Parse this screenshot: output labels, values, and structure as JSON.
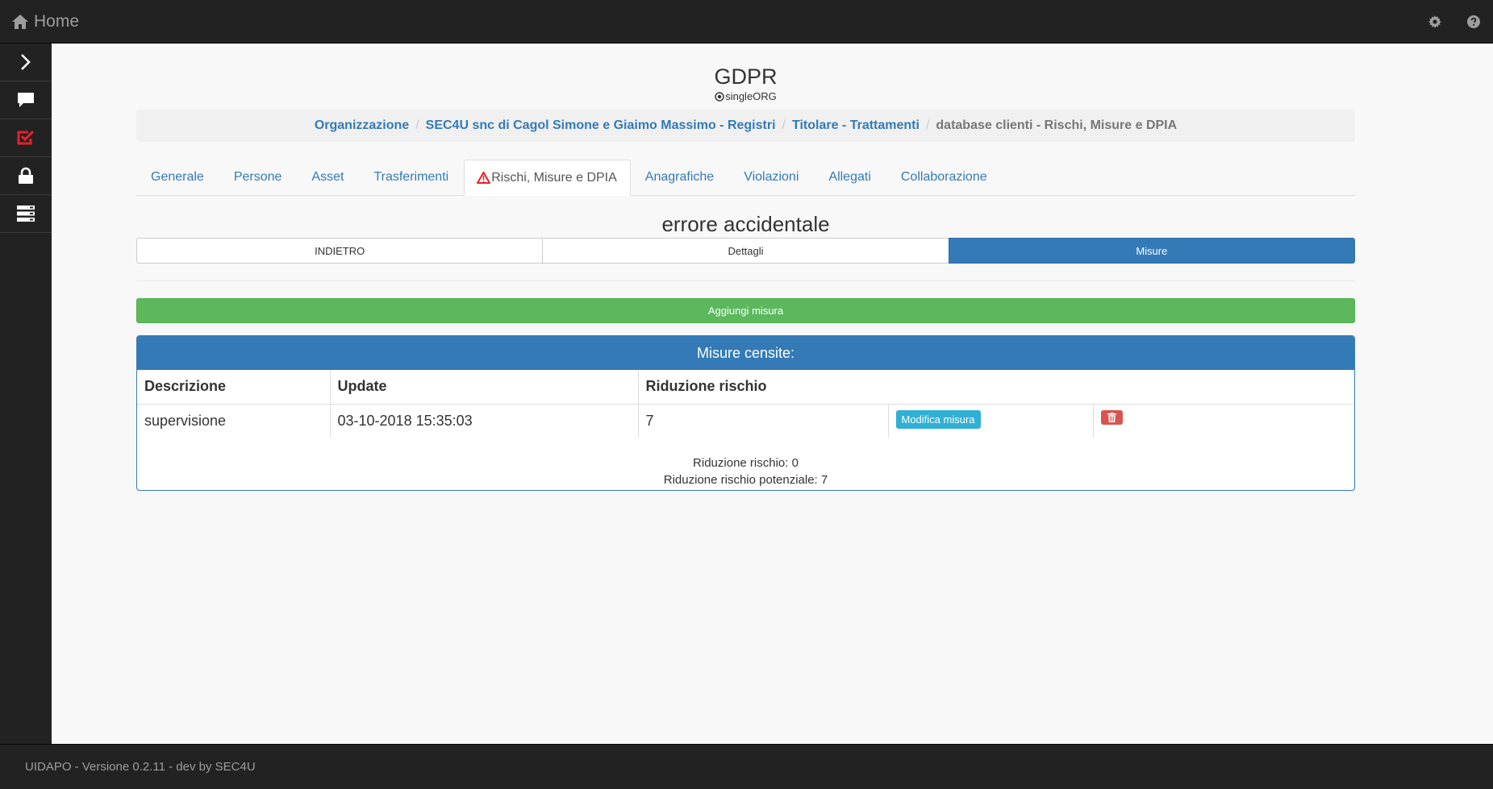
{
  "topbar": {
    "home_label": "Home"
  },
  "page": {
    "title": "GDPR",
    "subtitle": "singleORG"
  },
  "breadcrumb": {
    "items": [
      "Organizzazione",
      "SEC4U snc di Cagol Simone e Giaimo Massimo - Registri",
      "Titolare - Trattamenti"
    ],
    "active": "database clienti - Rischi, Misure e DPIA",
    "separator": "/"
  },
  "tabs": [
    "Generale",
    "Persone",
    "Asset",
    "Trasferimenti",
    "Rischi, Misure e DPIA",
    "Anagrafiche",
    "Violazioni",
    "Allegati",
    "Collaborazione"
  ],
  "section": {
    "title": "errore accidentale",
    "buttons": [
      "INDIETRO",
      "Dettagli",
      "Misure"
    ],
    "add_label": "Aggiungi misura"
  },
  "panel": {
    "heading": "Misure censite:",
    "columns": [
      "Descrizione",
      "Update",
      "Riduzione rischio"
    ],
    "rows": [
      {
        "descrizione": "supervisione",
        "update": "03-10-2018 15:35:03",
        "riduzione": "7",
        "edit_label": "Modifica misura"
      }
    ],
    "footer_line1": "Riduzione rischio: 0",
    "footer_line2": "Riduzione rischio potenziale: 7"
  },
  "footer": {
    "text": "UIDAPO - Versione 0.2.11 - dev by SEC4U"
  },
  "colors": {
    "primary": "#337ab7",
    "success": "#5cb85c",
    "info": "#31b0d5",
    "danger": "#d9534f",
    "dark": "#222222",
    "accent_red": "#e8202a"
  },
  "icons": [
    "home-icon",
    "gear-icon",
    "help-icon",
    "chevron-right-icon",
    "chat-icon",
    "checkbox-icon",
    "lock-icon",
    "server-icon",
    "warning-icon",
    "radio-icon",
    "trash-icon"
  ]
}
